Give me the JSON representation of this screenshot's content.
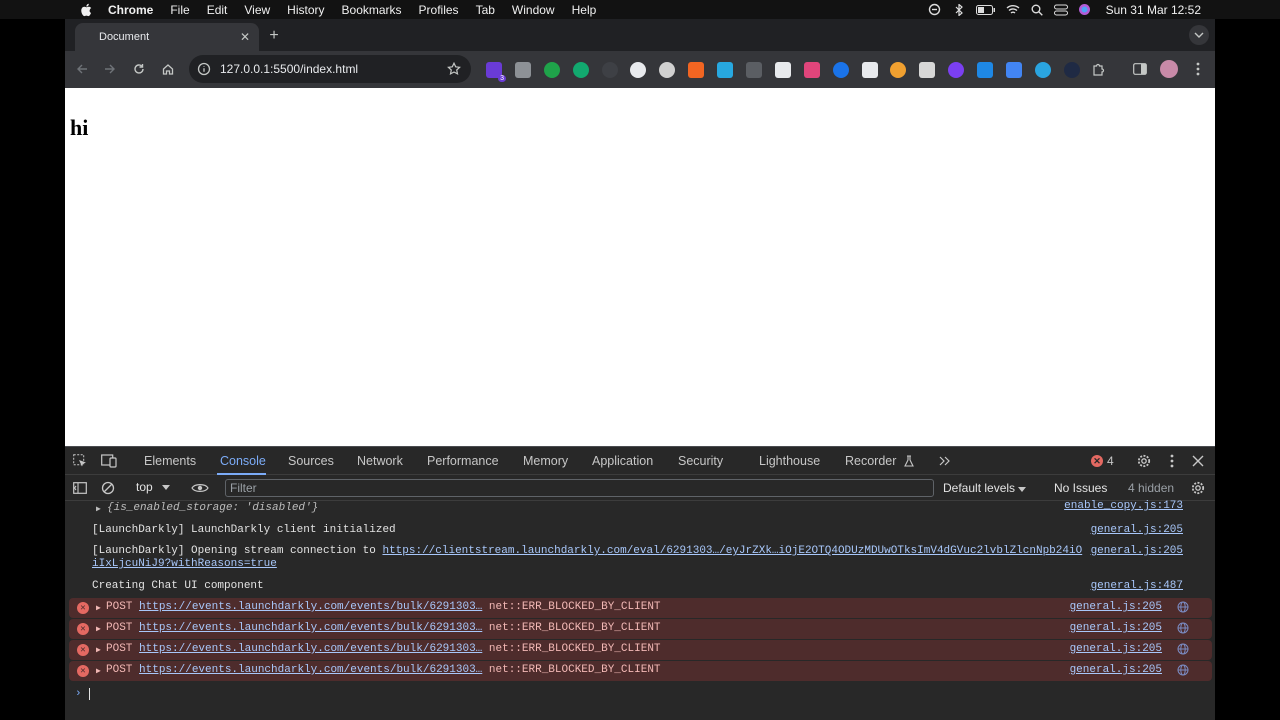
{
  "menubar": {
    "items": [
      "Chrome",
      "File",
      "Edit",
      "View",
      "History",
      "Bookmarks",
      "Profiles",
      "Tab",
      "Window",
      "Help"
    ],
    "clock": "Sun 31 Mar  12:52"
  },
  "browser": {
    "tab_title": "Document",
    "url": "127.0.0.1:5500/index.html",
    "extension_badge": "3"
  },
  "page": {
    "heading": "hi"
  },
  "devtools": {
    "tabs": [
      "Elements",
      "Console",
      "Sources",
      "Network",
      "Performance",
      "Memory",
      "Application",
      "Security",
      "Lighthouse",
      "Recorder"
    ],
    "active_tab": "Console",
    "error_count": "4",
    "context": "top",
    "filter_placeholder": "Filter",
    "levels": "Default levels",
    "issues": "No Issues",
    "hidden": "4 hidden"
  },
  "console": {
    "storage_obj": "{is_enabled_storage: 'disabled'}",
    "storage_src": "enable_copy.js:173",
    "init_msg": "[LaunchDarkly] LaunchDarkly client initialized",
    "init_src": "general.js:205",
    "stream_prefix": "[LaunchDarkly] Opening stream connection to",
    "stream_url_1": "https://clientstream.launchdarkly.com/eval/6291303…/eyJrZXk…iOjE2OTQ4ODUzMDUwOTksImV4dGVuc2lvblZlcnNpb24iO",
    "stream_url_2": "iIxLjcuNiJ9?withReasons=true",
    "stream_src": "general.js:205",
    "chat_msg": "Creating Chat UI component",
    "chat_src": "general.js:487",
    "errors": [
      {
        "method": "POST",
        "url": "https://events.launchdarkly.com/events/bulk/6291303…",
        "error": "net::ERR_BLOCKED_BY_CLIENT",
        "src": "general.js:205"
      },
      {
        "method": "POST",
        "url": "https://events.launchdarkly.com/events/bulk/6291303…",
        "error": "net::ERR_BLOCKED_BY_CLIENT",
        "src": "general.js:205"
      },
      {
        "method": "POST",
        "url": "https://events.launchdarkly.com/events/bulk/6291303…",
        "error": "net::ERR_BLOCKED_BY_CLIENT",
        "src": "general.js:205"
      },
      {
        "method": "POST",
        "url": "https://events.launchdarkly.com/events/bulk/6291303…",
        "error": "net::ERR_BLOCKED_BY_CLIENT",
        "src": "general.js:205"
      }
    ]
  }
}
